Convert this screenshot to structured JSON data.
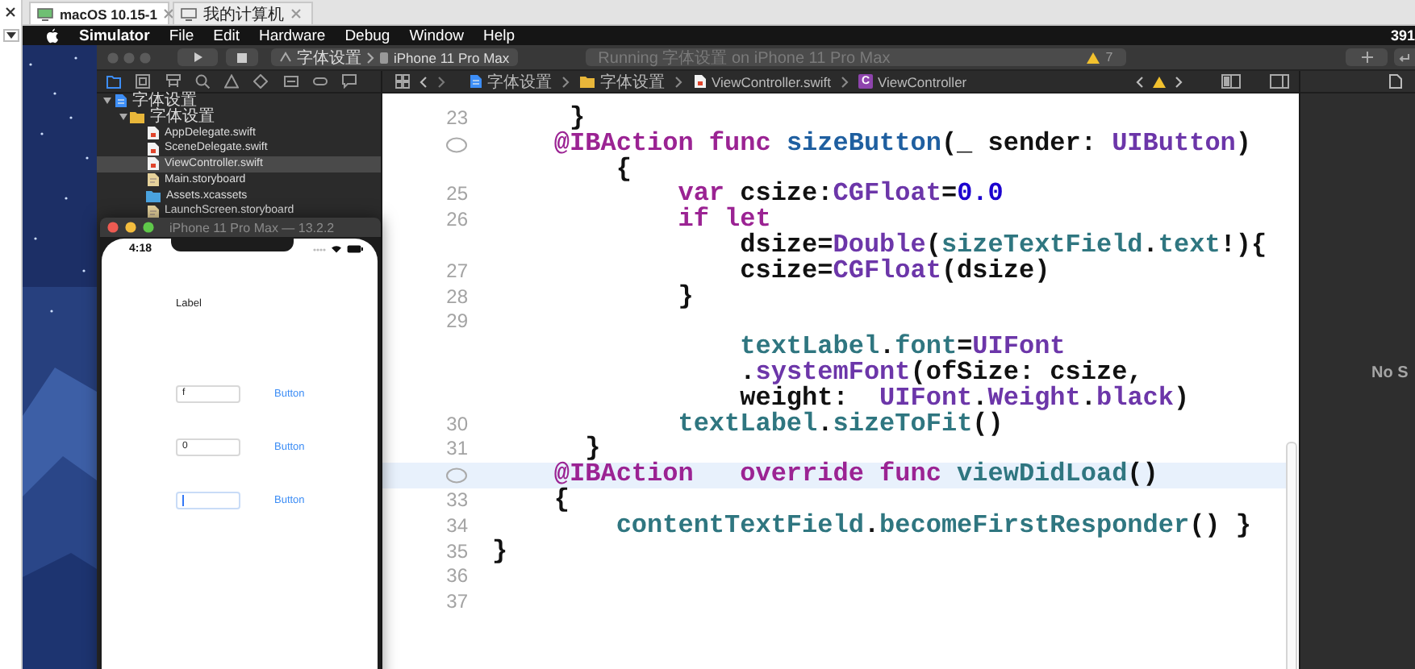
{
  "host_tabs": [
    {
      "label": "macOS 10.15-1",
      "selected": true
    },
    {
      "label": "我的计算机",
      "selected": false
    }
  ],
  "menu_bar": {
    "items": [
      "Simulator",
      "File",
      "Edit",
      "Hardware",
      "Debug",
      "Window",
      "Help"
    ],
    "status": "391"
  },
  "toolbar": {
    "scheme_target": "字体设置",
    "scheme_device": "iPhone 11 Pro Max",
    "activity": "Running 字体设置 on iPhone 11 Pro Max",
    "warning_count": "7"
  },
  "navigator": {
    "tabs": [
      {
        "selected": true
      },
      {
        "selected": false
      },
      {
        "selected": false
      },
      {
        "selected": false
      },
      {
        "selected": false
      },
      {
        "selected": false
      },
      {
        "selected": false
      },
      {
        "selected": false
      },
      {
        "selected": false
      }
    ],
    "tree": [
      {
        "name": "字体设置",
        "kind": "project",
        "expanded": true,
        "selected": false,
        "children": [
          {
            "name": "字体设置",
            "kind": "folder",
            "expanded": true,
            "selected": false,
            "children": [
              {
                "name": "AppDelegate.swift",
                "kind": "swift",
                "selected": false
              },
              {
                "name": "SceneDelegate.swift",
                "kind": "swift",
                "selected": false
              },
              {
                "name": "ViewController.swift",
                "kind": "swift",
                "selected": true
              },
              {
                "name": "Main.storyboard",
                "kind": "storyboard",
                "selected": false
              },
              {
                "name": "Assets.xcassets",
                "kind": "assets",
                "selected": false
              },
              {
                "name": "LaunchScreen.storyboard",
                "kind": "storyboard",
                "selected": false
              }
            ]
          }
        ]
      }
    ]
  },
  "jump_bar": [
    {
      "text": "字体设置",
      "kind": "project"
    },
    {
      "text": "字体设置",
      "kind": "folder"
    },
    {
      "text": "ViewController.swift",
      "kind": "swift"
    },
    {
      "text": "ViewController",
      "kind": "class",
      "badge": "C"
    }
  ],
  "editor": {
    "lines": [
      {
        "number": "23",
        "connector": false,
        "highlighted": false,
        "tokens": [
          {
            "kind": "plain",
            "text": "     }"
          }
        ]
      },
      {
        "connector": true,
        "highlighted": false,
        "tokens": [
          {
            "kind": "keyword",
            "text": "    @IBAction func "
          },
          {
            "kind": "decl",
            "text": "sizeButton"
          },
          {
            "kind": "plain",
            "text": "(_ sender: "
          },
          {
            "kind": "type",
            "text": "UIButton"
          },
          {
            "kind": "plain",
            "text": ")"
          }
        ]
      },
      {
        "connector": false,
        "highlighted": false,
        "tokens": [
          {
            "kind": "plain",
            "text": "        {"
          }
        ]
      },
      {
        "number": "25",
        "connector": false,
        "highlighted": false,
        "tokens": [
          {
            "kind": "keyword",
            "text": "            var "
          },
          {
            "kind": "plain",
            "text": "csize:"
          },
          {
            "kind": "type",
            "text": "CGFloat"
          },
          {
            "kind": "plain",
            "text": "="
          },
          {
            "kind": "number",
            "text": "0.0"
          }
        ]
      },
      {
        "number": "26",
        "connector": false,
        "highlighted": false,
        "tokens": [
          {
            "kind": "keyword",
            "text": "            if let"
          }
        ]
      },
      {
        "connector": false,
        "highlighted": false,
        "tokens": [
          {
            "kind": "plain",
            "text": "                dsize="
          },
          {
            "kind": "type",
            "text": "Double"
          },
          {
            "kind": "plain",
            "text": "("
          },
          {
            "kind": "ref",
            "text": "sizeTextField"
          },
          {
            "kind": "plain",
            "text": "."
          },
          {
            "kind": "ref",
            "text": "text"
          },
          {
            "kind": "plain",
            "text": "!){"
          }
        ]
      },
      {
        "number": "27",
        "connector": false,
        "highlighted": false,
        "tokens": [
          {
            "kind": "plain",
            "text": "                csize="
          },
          {
            "kind": "type",
            "text": "CGFloat"
          },
          {
            "kind": "plain",
            "text": "(dsize)"
          }
        ]
      },
      {
        "number": "28",
        "connector": false,
        "highlighted": false,
        "tokens": [
          {
            "kind": "plain",
            "text": "            }"
          }
        ]
      },
      {
        "number": "29",
        "connector": false,
        "highlighted": false
      },
      {
        "connector": false,
        "highlighted": false,
        "tokens": [
          {
            "kind": "ref",
            "text": "                textLabel"
          },
          {
            "kind": "plain",
            "text": "."
          },
          {
            "kind": "ref",
            "text": "font"
          },
          {
            "kind": "plain",
            "text": "="
          },
          {
            "kind": "type",
            "text": "UIFont"
          }
        ]
      },
      {
        "connector": false,
        "highlighted": false,
        "tokens": [
          {
            "kind": "plain",
            "text": "                ."
          },
          {
            "kind": "type",
            "text": "systemFont"
          },
          {
            "kind": "plain",
            "text": "(ofSize: csize,"
          }
        ]
      },
      {
        "connector": false,
        "highlighted": false,
        "tokens": [
          {
            "kind": "plain",
            "text": "                weight:  "
          },
          {
            "kind": "type",
            "text": "UIFont"
          },
          {
            "kind": "plain",
            "text": "."
          },
          {
            "kind": "type",
            "text": "Weight"
          },
          {
            "kind": "plain",
            "text": "."
          },
          {
            "kind": "type",
            "text": "black"
          },
          {
            "kind": "plain",
            "text": ")"
          }
        ]
      },
      {
        "number": "30",
        "connector": false,
        "highlighted": false,
        "tokens": [
          {
            "kind": "ref",
            "text": "            textLabel"
          },
          {
            "kind": "plain",
            "text": "."
          },
          {
            "kind": "ref",
            "text": "sizeToFit"
          },
          {
            "kind": "plain",
            "text": "()"
          }
        ]
      },
      {
        "number": "31",
        "connector": false,
        "highlighted": false,
        "tokens": [
          {
            "kind": "plain",
            "text": "      }"
          }
        ]
      },
      {
        "connector": true,
        "highlighted": true,
        "tokens": [
          {
            "kind": "keyword",
            "text": "    @IBAction   override func "
          },
          {
            "kind": "ref",
            "text": "viewDidLoad"
          },
          {
            "kind": "plain",
            "text": "()"
          }
        ]
      },
      {
        "number": "33",
        "connector": false,
        "highlighted": false,
        "tokens": [
          {
            "kind": "plain",
            "text": "    {"
          }
        ]
      },
      {
        "number": "34",
        "connector": false,
        "highlighted": false,
        "tokens": [
          {
            "kind": "ref",
            "text": "        contentTextField"
          },
          {
            "kind": "plain",
            "text": "."
          },
          {
            "kind": "ref",
            "text": "becomeFirstResponder"
          },
          {
            "kind": "plain",
            "text": "() }"
          }
        ]
      },
      {
        "number": "35",
        "connector": false,
        "highlighted": false,
        "tokens": [
          {
            "kind": "plain",
            "text": "}"
          }
        ]
      },
      {
        "number": "36",
        "connector": false,
        "highlighted": false
      },
      {
        "number": "37",
        "connector": false,
        "highlighted": false
      }
    ]
  },
  "inspector": {
    "message": "No S"
  },
  "simulator": {
    "title": "iPhone 11 Pro Max — 13.2.2",
    "time": "4:18",
    "label": "Label",
    "rows": [
      {
        "value": "f",
        "focused": false,
        "button": "Button"
      },
      {
        "value": "0",
        "focused": false,
        "button": "Button"
      },
      {
        "focused": true,
        "button": "Button"
      }
    ]
  }
}
